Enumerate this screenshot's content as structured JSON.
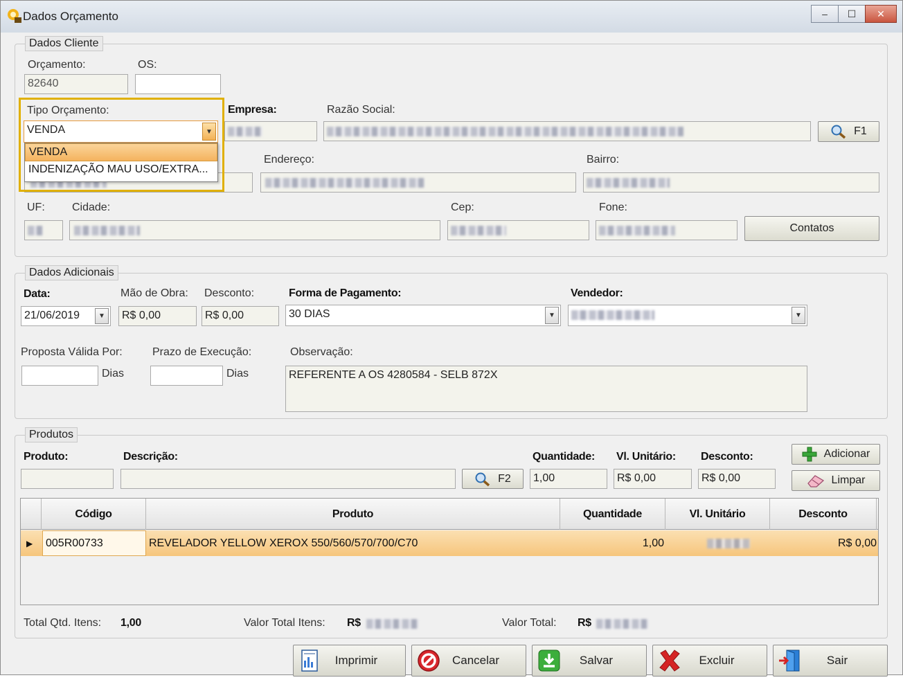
{
  "window": {
    "title": "Dados Orçamento",
    "controls": {
      "minimize": "–",
      "maximize": "☐",
      "close": "✕"
    }
  },
  "dados_cliente": {
    "group_title": "Dados Cliente",
    "orcamento_label": "Orçamento:",
    "orcamento_value": "82640",
    "os_label": "OS:",
    "os_value": "",
    "tipo_label": "Tipo Orçamento:",
    "tipo_value": "VENDA",
    "tipo_options": [
      "VENDA",
      "INDENIZAÇÃO  MAU  USO/EXTRA..."
    ],
    "empresa_label": "Empresa:",
    "razao_label": "Razão Social:",
    "f1_label": "F1",
    "endereco_label": "Endereço:",
    "bairro_label": "Bairro:",
    "uf_label": "UF:",
    "cidade_label": "Cidade:",
    "cep_label": "Cep:",
    "fone_label": "Fone:",
    "contatos_label": "Contatos"
  },
  "dados_adicionais": {
    "group_title": "Dados Adicionais",
    "data_label": "Data:",
    "data_value": "21/06/2019",
    "mao_obra_label": "Mão de Obra:",
    "mao_obra_value": "R$ 0,00",
    "desconto_label": "Desconto:",
    "desconto_value": "R$ 0,00",
    "forma_pagamento_label": "Forma de Pagamento:",
    "forma_pagamento_value": "30 DIAS",
    "vendedor_label": "Vendedor:",
    "proposta_label": "Proposta Válida Por:",
    "proposta_unit": "Dias",
    "prazo_label": "Prazo de Execução:",
    "prazo_unit": "Dias",
    "observacao_label": "Observação:",
    "observacao_value": "REFERENTE A OS 4280584 - SELB 872X"
  },
  "produtos": {
    "group_title": "Produtos",
    "produto_label": "Produto:",
    "descricao_label": "Descrição:",
    "f2_label": "F2",
    "quantidade_label": "Quantidade:",
    "quantidade_value": "1,00",
    "vl_unitario_label": "Vl. Unitário:",
    "vl_unitario_value": "R$ 0,00",
    "desconto_label": "Desconto:",
    "desconto_value": "R$ 0,00",
    "adicionar_label": "Adicionar",
    "limpar_label": "Limpar",
    "grid": {
      "columns": [
        "Código",
        "Produto",
        "Quantidade",
        "Vl. Unitário",
        "Desconto"
      ],
      "rows": [
        {
          "codigo": "005R00733",
          "produto": "REVELADOR YELLOW XEROX 550/560/570/700/C70",
          "quantidade": "1,00",
          "desconto": "R$ 0,00"
        }
      ]
    },
    "total_qtd_label": "Total Qtd. Itens:",
    "total_qtd_value": "1,00",
    "valor_total_itens_label": "Valor Total Itens:",
    "valor_total_itens_prefix": "R$",
    "valor_total_label": "Valor Total:",
    "valor_total_prefix": "R$"
  },
  "footer": {
    "imprimir": "Imprimir",
    "cancelar": "Cancelar",
    "salvar": "Salvar",
    "excluir": "Excluir",
    "sair": "Sair"
  },
  "colors": {
    "highlight": "#e0b000",
    "selection": "#f6c57c"
  }
}
